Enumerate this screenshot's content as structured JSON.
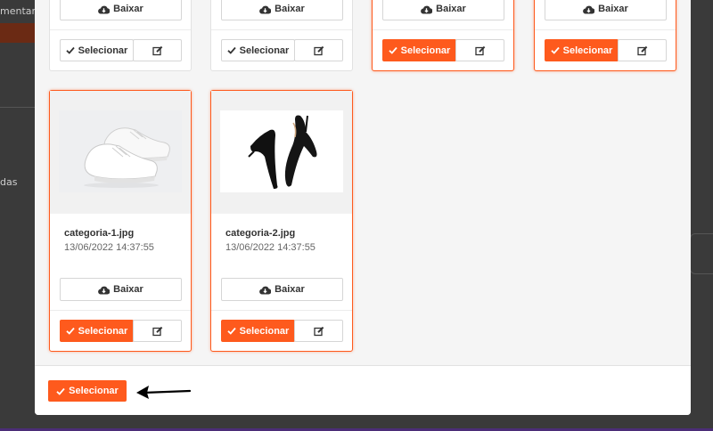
{
  "background": {
    "text_top": "mentare",
    "text_mid": "das"
  },
  "gallery": {
    "download_label": "Baixar",
    "select_label": "Selecionar",
    "top_cards": [
      {
        "selected": false
      },
      {
        "selected": false
      },
      {
        "selected": true
      },
      {
        "selected": true
      }
    ],
    "cards": [
      {
        "filename": "categoria-1.jpg",
        "date": "13/06/2022 14:37:55",
        "selected": true,
        "image": "white-sneakers"
      },
      {
        "filename": "categoria-2.jpg",
        "date": "13/06/2022 14:37:55",
        "selected": true,
        "image": "black-high-heels"
      }
    ]
  },
  "footer": {
    "select_button_label": "Selecionar",
    "annotation": "arrow-pointing-left"
  },
  "colors": {
    "accent": "#fe5a1d",
    "modal_bg": "#f5f5f5"
  }
}
